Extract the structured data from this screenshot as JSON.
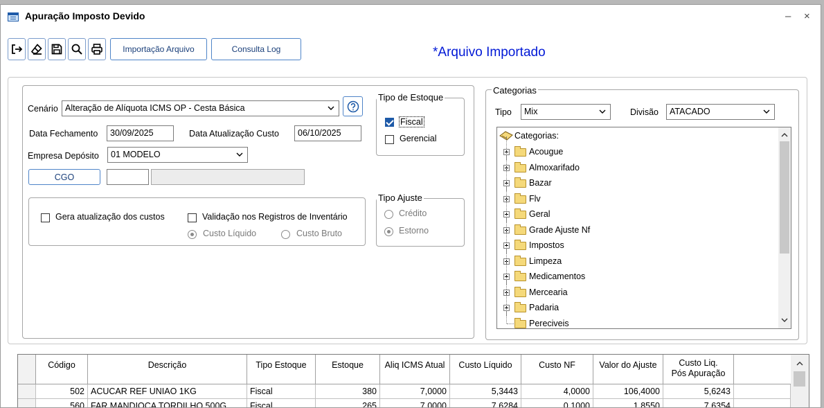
{
  "window": {
    "title": "Apuração Imposto Devido",
    "minimize": "–",
    "close": "×"
  },
  "toolbar": {
    "exit_icon": "exit-icon",
    "clear_icon": "eraser-icon",
    "save_icon": "save-icon",
    "search_icon": "search-icon",
    "print_icon": "print-icon",
    "import_label": "Importação Arquivo",
    "log_label": "Consulta Log",
    "status_text": "*Arquivo Importado"
  },
  "form": {
    "cenario_label": "Cenário",
    "cenario_value": "Alteração de Alíquota ICMS OP - Cesta Básica",
    "data_fechamento_label": "Data Fechamento",
    "data_fechamento_value": "30/09/2025",
    "data_atualizacao_label": "Data Atualização Custo",
    "data_atualizacao_value": "06/10/2025",
    "empresa_label": "Empresa Depósito",
    "empresa_value": "01 MODELO",
    "cgo_label": "CGO",
    "cgo_code": "",
    "cgo_desc": "",
    "gera_atualizacao_label": "Gera atualização dos custos",
    "validacao_label": "Validação nos Registros de Inventário",
    "custo_liquido_label": "Custo Líquido",
    "custo_bruto_label": "Custo Bruto"
  },
  "tipo_estoque": {
    "legend": "Tipo de Estoque",
    "fiscal_label": "Fiscal",
    "fiscal_checked": true,
    "gerencial_label": "Gerencial",
    "gerencial_checked": false
  },
  "tipo_ajuste": {
    "legend": "Tipo Ajuste",
    "credito_label": "Crédito",
    "estorno_label": "Estorno",
    "selected": "Estorno"
  },
  "categorias": {
    "legend": "Categorias",
    "tipo_label": "Tipo",
    "tipo_value": "Mix",
    "divisao_label": "Divisão",
    "divisao_value": "ATACADO",
    "root_label": "Categorias:",
    "items": [
      "Acougue",
      "Almoxarifado",
      "Bazar",
      "Flv",
      "Geral",
      "Grade Ajuste Nf",
      "Impostos",
      "Limpeza",
      "Medicamentos",
      "Mercearia",
      "Padaria",
      "Pereciveis"
    ]
  },
  "table": {
    "headers": {
      "codigo": "Código",
      "descricao": "Descrição",
      "tipo_estoque": "Tipo Estoque",
      "estoque": "Estoque",
      "aliq": "Aliq ICMS Atual",
      "custo_liquido": "Custo Líquido",
      "custo_nf": "Custo NF",
      "valor_ajuste": "Valor do Ajuste",
      "custo_pos_1": "Custo Liq.",
      "custo_pos_2": "Pós Apuração"
    },
    "rows": [
      {
        "codigo": "502",
        "descricao": "ACUCAR REF UNIAO 1KG",
        "tipo_estoque": "Fiscal",
        "estoque": "380",
        "aliq": "7,0000",
        "custo_liquido": "5,3443",
        "custo_nf": "4,0000",
        "valor_ajuste": "106,4000",
        "custo_pos": "5,6243"
      },
      {
        "codigo": "560",
        "descricao": "FAR MANDIOCA TORDILHO 500G",
        "tipo_estoque": "Fiscal",
        "estoque": "265",
        "aliq": "7,0000",
        "custo_liquido": "7,6284",
        "custo_nf": "0,1000",
        "valor_ajuste": "1,8550",
        "custo_pos": "7,6354"
      }
    ]
  },
  "colors": {
    "accent": "#1e5aa8",
    "status_text": "#0018d6",
    "folder": "#f5d97a"
  }
}
